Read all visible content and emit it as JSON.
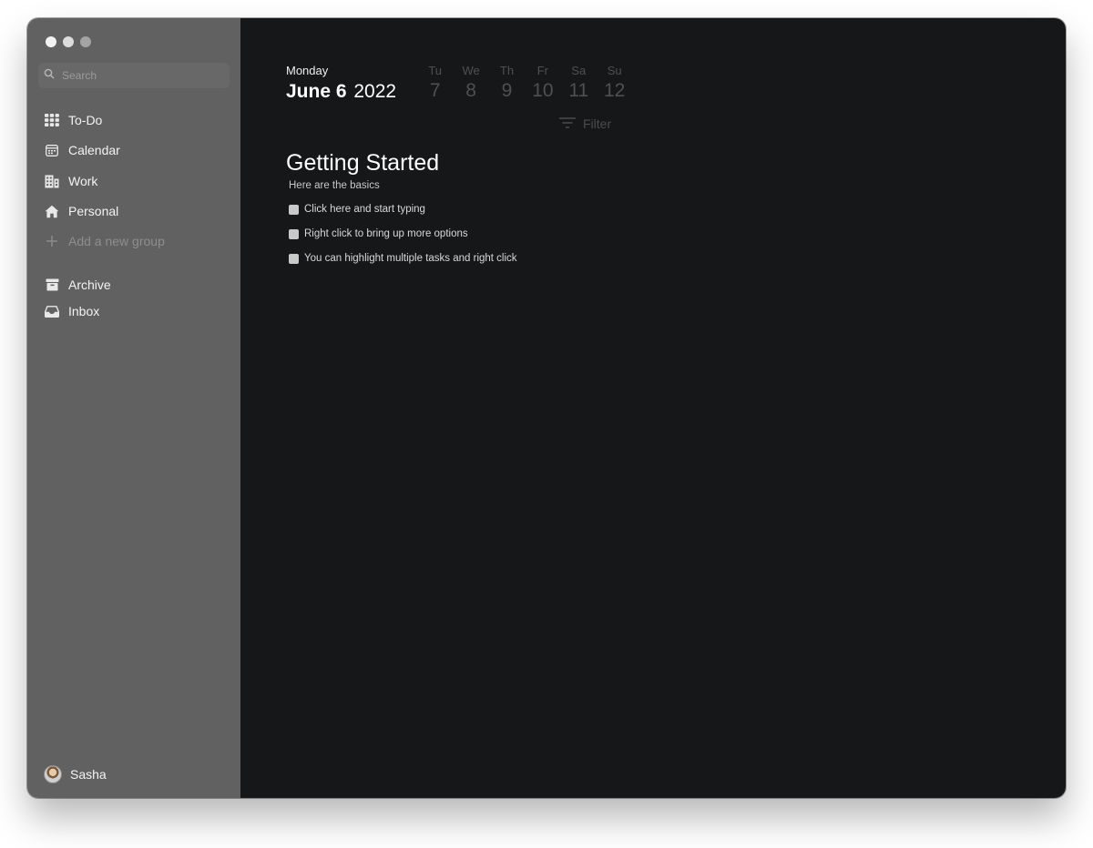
{
  "sidebar": {
    "search": {
      "placeholder": "Search"
    },
    "items": [
      {
        "label": "To-Do",
        "icon": "grid-icon"
      },
      {
        "label": "Calendar",
        "icon": "calendar-icon"
      },
      {
        "label": "Work",
        "icon": "building-icon"
      },
      {
        "label": "Personal",
        "icon": "home-icon"
      }
    ],
    "add_group_label": "Add a new group",
    "archive_label": "Archive",
    "inbox_label": "Inbox",
    "user_name": "Sasha"
  },
  "main": {
    "weekday": "Monday",
    "month_day": "June 6",
    "year": "2022",
    "week": [
      {
        "name": "Tu",
        "date": "7"
      },
      {
        "name": "We",
        "date": "8"
      },
      {
        "name": "Th",
        "date": "9"
      },
      {
        "name": "Fr",
        "date": "10"
      },
      {
        "name": "Sa",
        "date": "11"
      },
      {
        "name": "Su",
        "date": "12"
      }
    ],
    "filter_label": "Filter",
    "group_title": "Getting Started",
    "group_subtitle": "Here are the basics",
    "tasks": [
      {
        "text": "Click here and start typing"
      },
      {
        "text": "Right click to bring up more options"
      },
      {
        "text": "You can highlight multiple tasks and right click"
      }
    ]
  },
  "colors": {
    "sidebar_bg": "#616161",
    "main_bg": "#161719",
    "muted_text": "#4f5052"
  }
}
